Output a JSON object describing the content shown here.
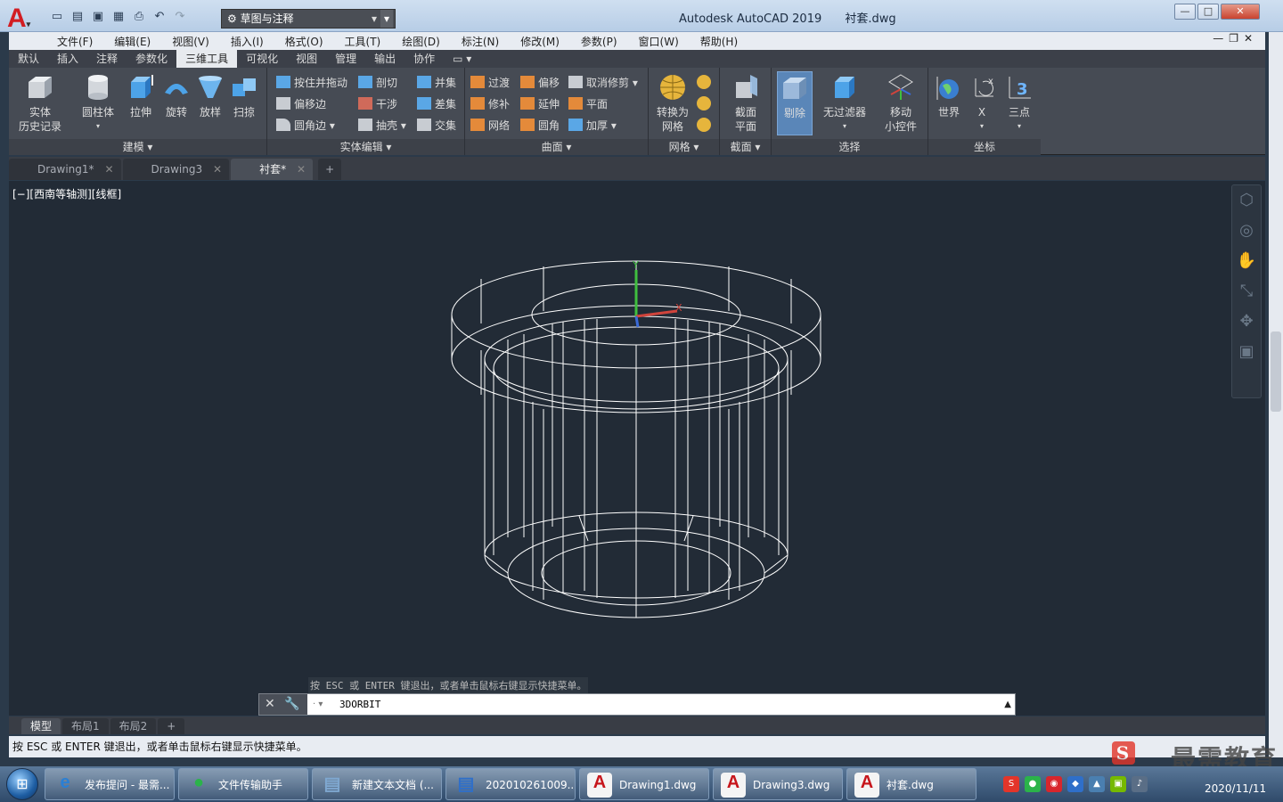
{
  "window": {
    "app_title": "Autodesk AutoCAD 2019",
    "doc_title": "衬套.dwg"
  },
  "workspace": {
    "label": "草图与注释"
  },
  "menu": [
    "文件(F)",
    "编辑(E)",
    "视图(V)",
    "插入(I)",
    "格式(O)",
    "工具(T)",
    "绘图(D)",
    "标注(N)",
    "修改(M)",
    "参数(P)",
    "窗口(W)",
    "帮助(H)"
  ],
  "ribbon_tabs": [
    "默认",
    "插入",
    "注释",
    "参数化",
    "三维工具",
    "可视化",
    "视图",
    "管理",
    "输出",
    "协作"
  ],
  "ribbon_active": "三维工具",
  "ribbon": {
    "modeling": {
      "title": "建模 ▾",
      "solid_history": "实体\n历史记录",
      "cylinder": "圆柱体",
      "extrude": "拉伸",
      "revolve": "旋转",
      "loft": "放样",
      "sweep": "扫掠"
    },
    "solid_edit": {
      "title": "实体编辑 ▾",
      "presspull": "按住并拖动",
      "offset_edge": "偏移边",
      "fillet_edge": "圆角边 ▾",
      "slice": "剖切",
      "interfere": "干涉",
      "shell": "抽壳 ▾",
      "union": "并集",
      "subtract": "差集",
      "intersect": "交集"
    },
    "surface": {
      "title": "曲面 ▾",
      "blend": "过渡",
      "offset": "偏移",
      "untrim": "取消修剪 ▾",
      "patch": "修补",
      "extend": "延伸",
      "planar": "平面",
      "network": "网络",
      "fillet": "圆角",
      "thicken": "加厚 ▾"
    },
    "mesh": {
      "title": "网格 ▾",
      "convert": "转换为\n网格"
    },
    "section": {
      "title": "截面 ▾",
      "section_plane": "截面\n平面"
    },
    "selection": {
      "title": "选择",
      "cull": "剔除",
      "no_filter": "无过滤器",
      "move_gizmo": "移动\n小控件"
    },
    "coords": {
      "title": "坐标",
      "world": "世界",
      "x": "X",
      "three_point": "三点"
    }
  },
  "doc_tabs": [
    {
      "label": "Drawing1*",
      "active": false
    },
    {
      "label": "Drawing3",
      "active": false
    },
    {
      "label": "衬套*",
      "active": true
    }
  ],
  "viewport": {
    "label": "[−][西南等轴测][线框]"
  },
  "command": {
    "hint": "按 ESC 或 ENTER 键退出，或者单击鼠标右键显示快捷菜单。",
    "input": "3DORBIT"
  },
  "layout_tabs": [
    "模型",
    "布局1",
    "布局2"
  ],
  "status_text": "按 ESC 或 ENTER 键退出，或者单击鼠标右键显示快捷菜单。",
  "watermark": "最需教育",
  "taskbar": [
    {
      "label": "发布提问 - 最需...",
      "icon": "ie-icon",
      "color": "#2a7fd4"
    },
    {
      "label": "文件传输助手",
      "icon": "wechat-icon",
      "color": "#2bb34a"
    },
    {
      "label": "新建文本文档 (...",
      "icon": "notepad-icon",
      "color": "#7fa8d1"
    },
    {
      "label": "202010261009...",
      "icon": "app-icon",
      "color": "#2f6fc9"
    },
    {
      "label": "Drawing1.dwg",
      "icon": "autocad-icon",
      "color": "#c7161c"
    },
    {
      "label": "Drawing3.dwg",
      "icon": "autocad-icon",
      "color": "#c7161c"
    },
    {
      "label": "衬套.dwg",
      "icon": "autocad-icon",
      "color": "#c7161c"
    }
  ],
  "clock": {
    "date": "2020/11/11"
  },
  "colors": {
    "accent": "#c7161c",
    "wire": "#ffffff",
    "axis_x": "#d0443c",
    "axis_y": "#3fbf3f",
    "axis_z": "#3a6ad8"
  }
}
